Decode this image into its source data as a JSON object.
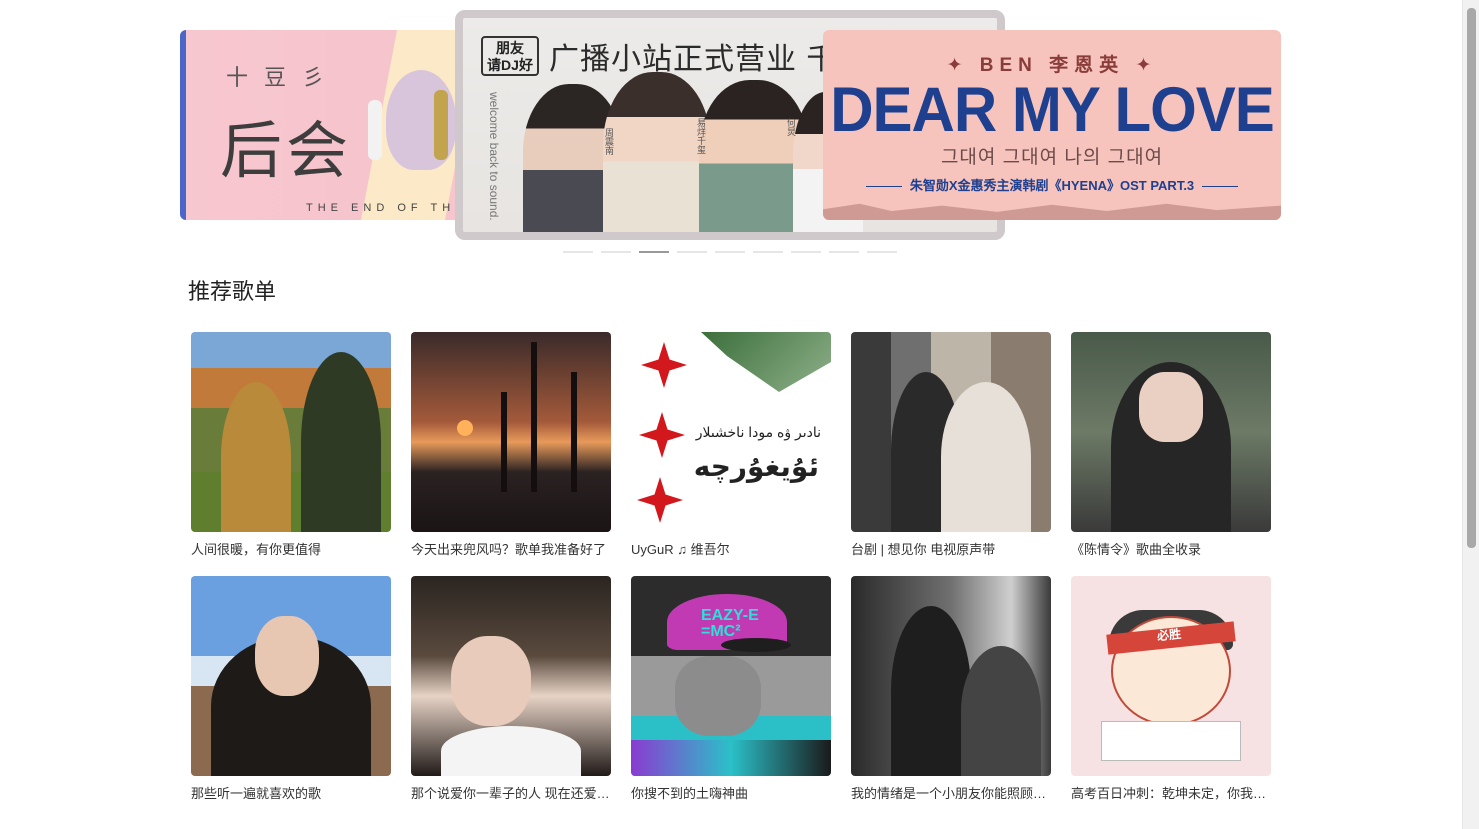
{
  "carousel": {
    "left": {
      "small": "十豆彡",
      "big": "后会",
      "sub": "THE END OF THE W"
    },
    "center": {
      "logo_line1": "朋友",
      "logo_line2": "请DJ好",
      "headline": "广播小站正式营业 千玺啊",
      "welcome": "welcome back to sound.",
      "captions": [
        "周震南",
        "易烊千玺",
        "何炅"
      ]
    },
    "right": {
      "artist": "✦ BEN 李恩英 ✦",
      "title": "DEAR MY LOVE",
      "korean": "그대여 그대여 나의 그대여",
      "ost": "朱智勋X金惠秀主演韩剧《HYENA》OST PART.3"
    },
    "dots_count": 9,
    "active_dot": 2
  },
  "section": {
    "title": "推荐歌单"
  },
  "playlists": [
    {
      "title": "人间很暖，有你更值得"
    },
    {
      "title": "今天出来兜风吗？歌单我准备好了"
    },
    {
      "title": "UyGuR ♫ 维吾尔"
    },
    {
      "title": "台剧 | 想见你 电视原声带"
    },
    {
      "title": "《陈情令》歌曲全收录"
    },
    {
      "title": "那些听一遍就喜欢的歌"
    },
    {
      "title": "那个说爱你一辈子的人 现在还爱你吗"
    },
    {
      "title": "你搜不到的土嗨神曲"
    },
    {
      "title": "我的情绪是一个小朋友你能照顾它吗"
    },
    {
      "title": "高考百日冲刺：乾坤未定，你我皆是黑马"
    }
  ],
  "covers": {
    "uyghur_line1": "نادىر ۋە مودا ناخشىلار",
    "uyghur_line2": "ئۇيغۇرچە",
    "hat_text_1": "EAZY-E",
    "hat_text_2": "=MC²",
    "band_text": "必胜"
  }
}
